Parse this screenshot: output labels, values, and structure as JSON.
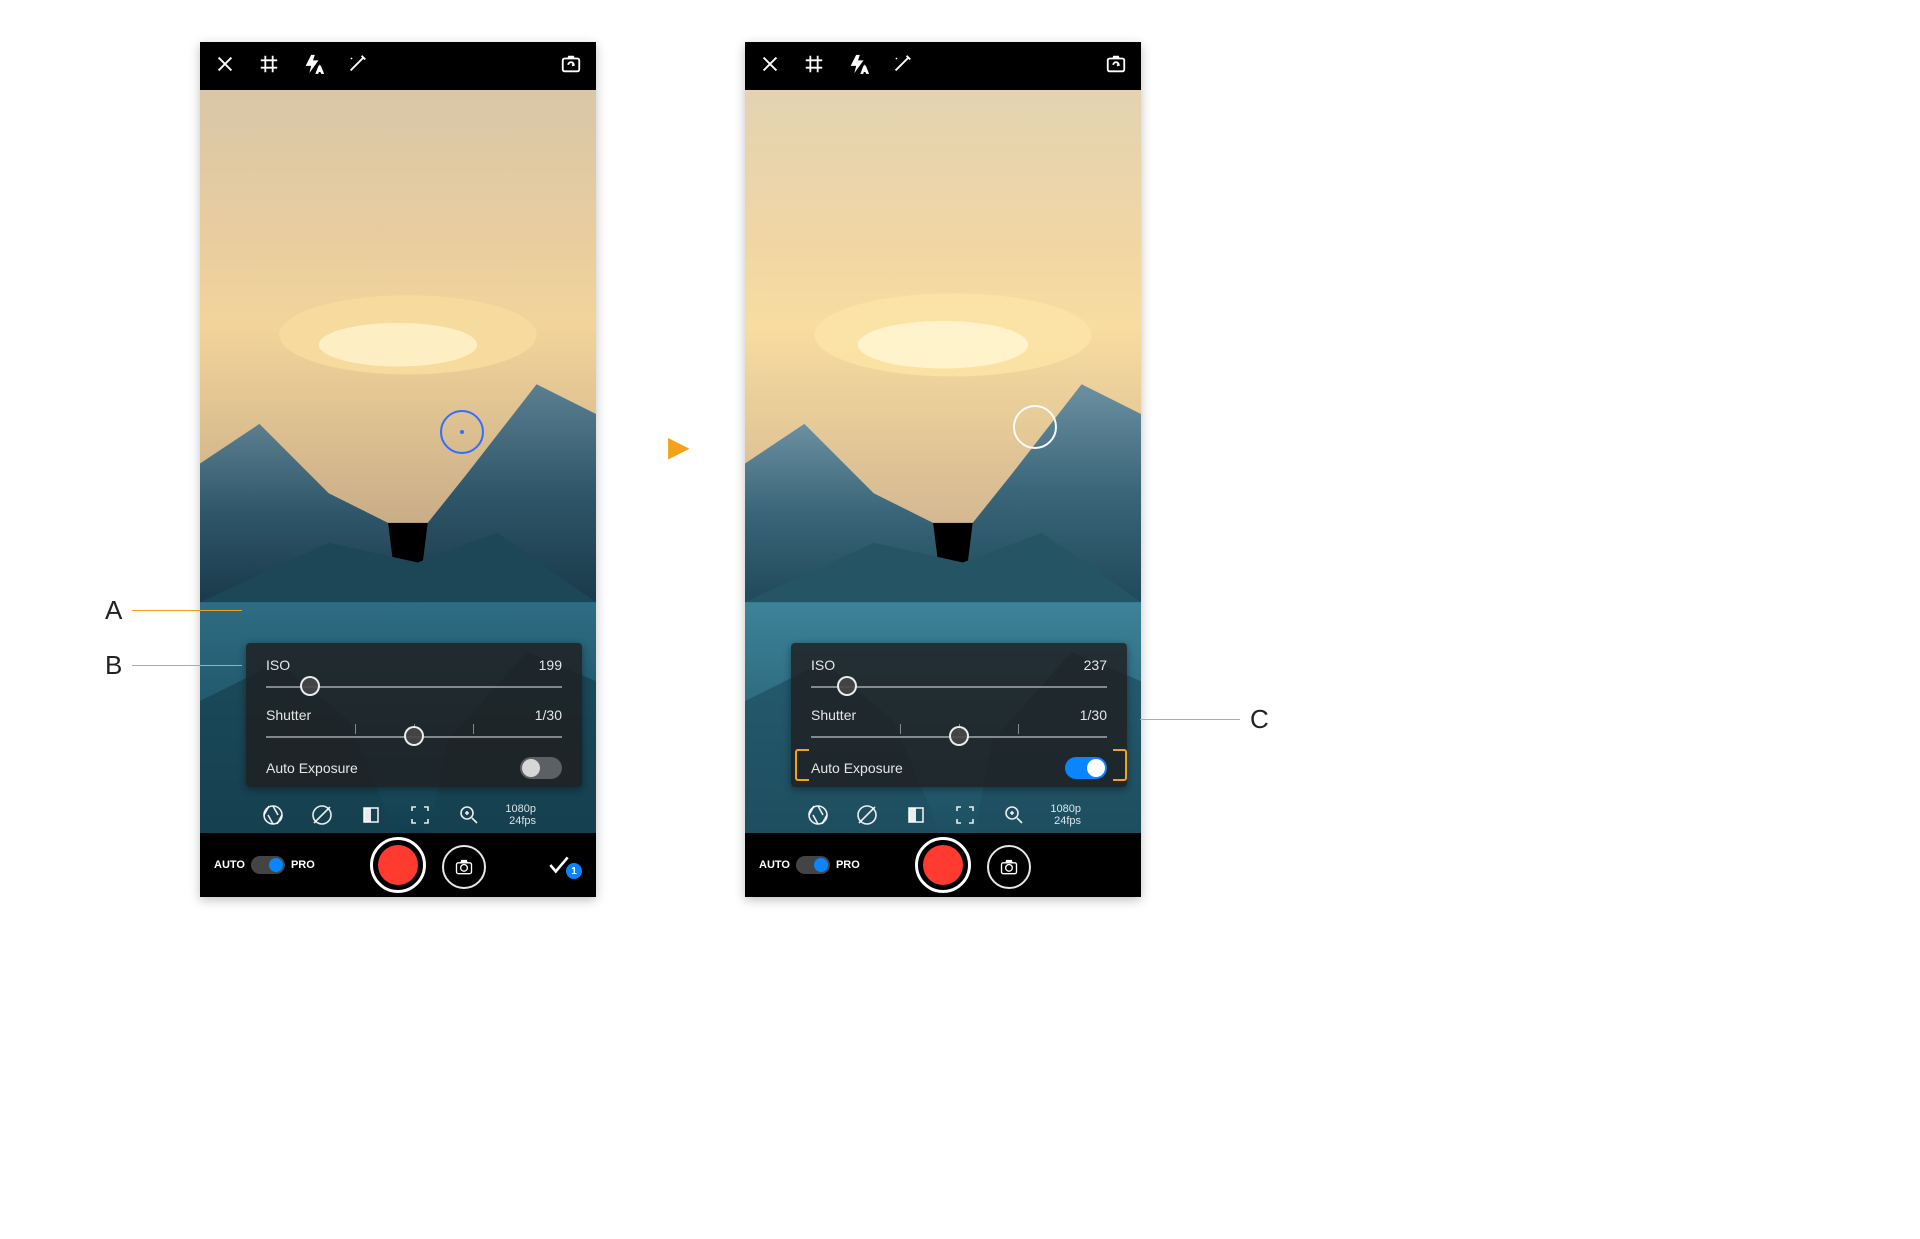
{
  "callouts": {
    "A": "A",
    "B": "B",
    "C": "C"
  },
  "left": {
    "iso_label": "ISO",
    "iso_value": "199",
    "shutter_label": "Shutter",
    "shutter_value": "1/30",
    "ae_label": "Auto Exposure",
    "ae_on": false,
    "iso_pos_pct": 15,
    "shutter_pos_pct": 50,
    "resolution_line1": "1080p",
    "resolution_line2": "24fps",
    "mode_auto": "AUTO",
    "mode_pro": "PRO",
    "gallery_count": "1"
  },
  "right": {
    "iso_label": "ISO",
    "iso_value": "237",
    "shutter_label": "Shutter",
    "shutter_value": "1/30",
    "ae_label": "Auto Exposure",
    "ae_on": true,
    "iso_pos_pct": 12,
    "shutter_pos_pct": 50,
    "resolution_line1": "1080p",
    "resolution_line2": "24fps",
    "mode_auto": "AUTO",
    "mode_pro": "PRO"
  },
  "accent": "#f5a21b"
}
